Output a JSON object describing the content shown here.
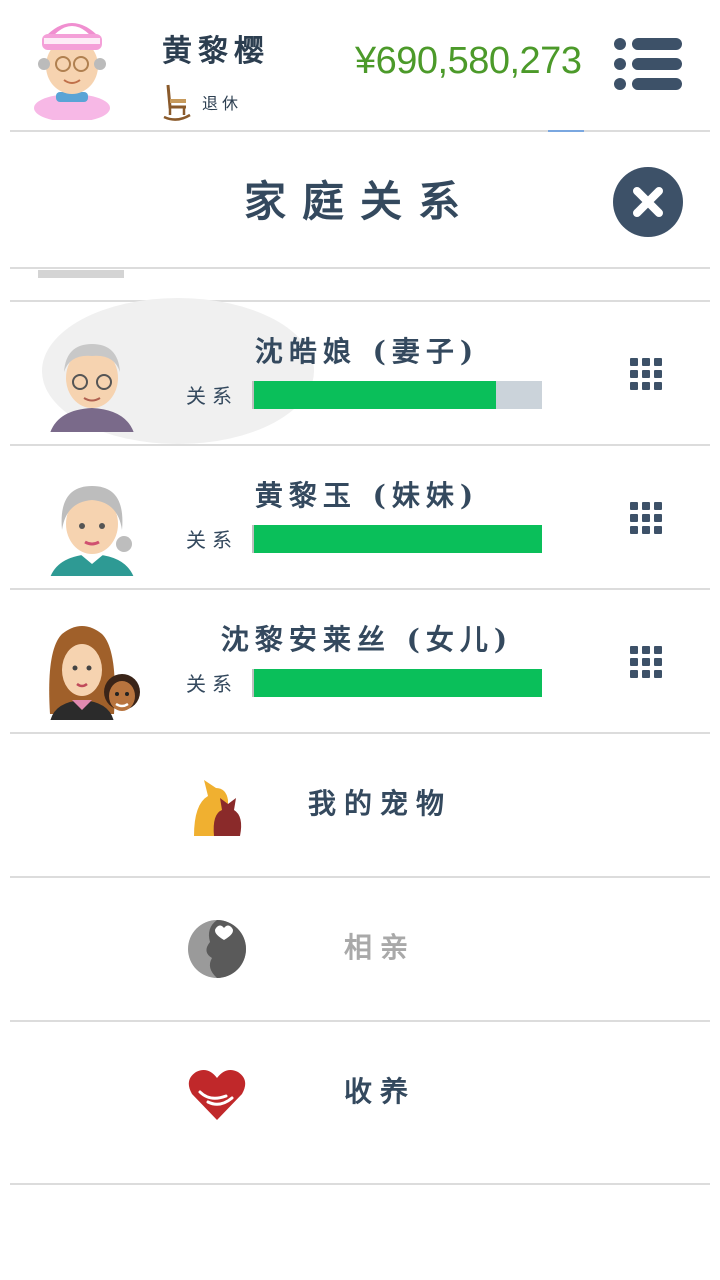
{
  "header": {
    "player_name": "黄黎樱",
    "status": "退休",
    "money": "¥690,580,273"
  },
  "title": "家庭关系",
  "relation_label": "关系",
  "family": [
    {
      "name": "沈皓娘 (妻子)",
      "relation_pct": 84
    },
    {
      "name": "黄黎玉 (妹妹)",
      "relation_pct": 100
    },
    {
      "name": "沈黎安莱丝 (女儿)",
      "relation_pct": 100
    }
  ],
  "actions": [
    {
      "label": "我的宠物",
      "icon": "pet-icon",
      "enabled": true
    },
    {
      "label": "相亲",
      "icon": "dating-icon",
      "enabled": false
    },
    {
      "label": "收养",
      "icon": "adopt-heart-icon",
      "enabled": true
    }
  ],
  "colors": {
    "accent": "#3d5168",
    "money": "#4c9a2a",
    "bar_fill": "#0abf5a",
    "bar_track": "#cbd3da"
  }
}
